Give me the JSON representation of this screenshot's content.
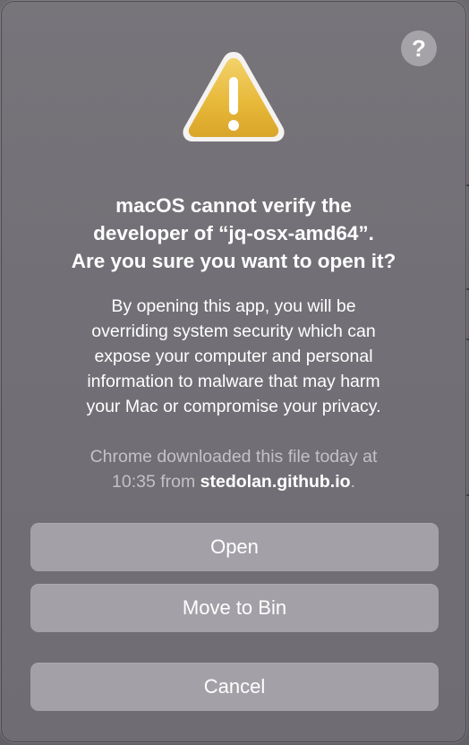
{
  "dialog": {
    "help_label": "?",
    "icon": "warning-triangle-icon",
    "title_lines": [
      "macOS cannot verify the",
      "developer of “jq-osx-amd64”.",
      "Are you sure you want to open it?"
    ],
    "body_lines": [
      "By opening this app, you will be",
      "overriding system security which can",
      "expose your computer and personal",
      "information to malware that may harm",
      "your Mac or compromise your privacy."
    ],
    "source": {
      "line1": "Chrome downloaded this file today at",
      "line2_prefix": "10:35 from ",
      "host": "stedolan.github.io",
      "line2_suffix": "."
    },
    "buttons": {
      "open": "Open",
      "move_to_bin": "Move to Bin",
      "cancel": "Cancel"
    }
  },
  "colors": {
    "dialog_background": "#727076",
    "button_background": "#a3a1a7",
    "warning_yellow": "#e8b93a",
    "secondary_text": "#c3c1c6"
  }
}
